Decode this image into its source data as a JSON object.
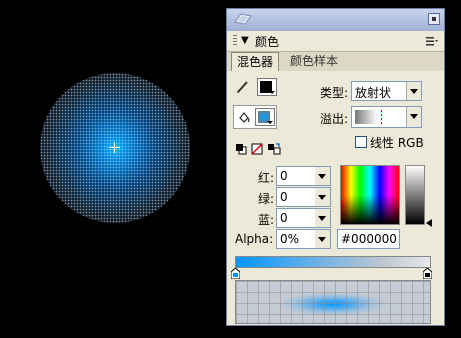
{
  "panel": {
    "title": "颜色",
    "tabs": [
      {
        "label": "混色器"
      },
      {
        "label": "颜色样本"
      }
    ]
  },
  "mixer": {
    "type_label": "类型:",
    "type_value": "放射状",
    "overflow_label": "溢出:",
    "linear_rgb_label": "线性 RGB",
    "red_label": "红:",
    "red_value": "0",
    "green_label": "绿:",
    "green_value": "0",
    "blue_label": "蓝:",
    "blue_value": "0",
    "alpha_label": "Alpha:",
    "alpha_value": "0%",
    "hex_value": "#000000"
  },
  "colors": {
    "stroke_color": "#000000",
    "fill_color": "#00a0ff",
    "gradient_start": "#0096ff",
    "gradient_end": "#e8e8e8"
  },
  "icons": [
    "pencil-icon",
    "paint-bucket-icon",
    "black-white-icon",
    "no-color-icon",
    "swap-colors-icon",
    "options-menu-icon",
    "close-icon"
  ]
}
